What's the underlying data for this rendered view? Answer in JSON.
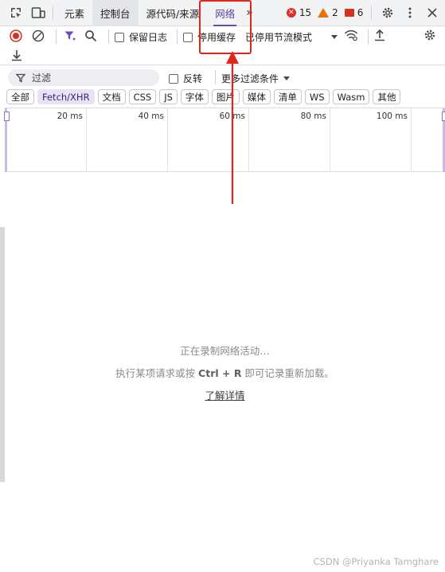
{
  "tabs": {
    "elements": "元素",
    "console": "控制台",
    "sources": "源代码/来源",
    "network": "网络",
    "more": "»"
  },
  "counters": {
    "errors": "15",
    "warnings": "2",
    "issues": "6"
  },
  "toolbar": {
    "preserve_log": "保留日志",
    "disable_cache": "停用缓存",
    "throttle": "已停用节流模式"
  },
  "filter": {
    "placeholder": "过滤",
    "invert": "反转",
    "more_filters": "更多过滤条件"
  },
  "type_filters": [
    "全部",
    "Fetch/XHR",
    "文档",
    "CSS",
    "JS",
    "字体",
    "图片",
    "媒体",
    "清单",
    "WS",
    "Wasm",
    "其他"
  ],
  "active_type_filter": "Fetch/XHR",
  "overview": {
    "ticks": [
      "20 ms",
      "40 ms",
      "60 ms",
      "80 ms",
      "100 ms"
    ]
  },
  "empty_state": {
    "title": "正在录制网络活动…",
    "hint_prefix": "执行某项请求或按 ",
    "hint_key": "Ctrl + R",
    "hint_suffix": " 即可记录重新加载。",
    "link": "了解详情"
  },
  "watermark": "CSDN @Priyanka Tamghare",
  "colors": {
    "accent": "#6a4bb5",
    "record": "#d93025",
    "highlight": "#e0251b",
    "filter_active": "#5b3fa3"
  }
}
